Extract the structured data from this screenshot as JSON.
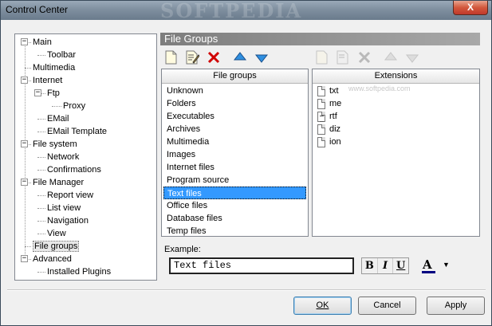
{
  "window": {
    "title": "Control Center",
    "watermark": "SOFTPEDIA",
    "close_label": "X"
  },
  "tree": {
    "items": [
      {
        "label": "Main",
        "level": 0,
        "expander": "−"
      },
      {
        "label": "Toolbar",
        "level": 1
      },
      {
        "label": "Multimedia",
        "level": 0
      },
      {
        "label": "Internet",
        "level": 0,
        "expander": "−"
      },
      {
        "label": "Ftp",
        "level": 1,
        "expander": "−"
      },
      {
        "label": "Proxy",
        "level": 2
      },
      {
        "label": "EMail",
        "level": 1
      },
      {
        "label": "EMail Template",
        "level": 1
      },
      {
        "label": "File system",
        "level": 0,
        "expander": "−"
      },
      {
        "label": "Network",
        "level": 1
      },
      {
        "label": "Confirmations",
        "level": 1
      },
      {
        "label": "File Manager",
        "level": 0,
        "expander": "−"
      },
      {
        "label": "Report view",
        "level": 1
      },
      {
        "label": "List view",
        "level": 1
      },
      {
        "label": "Navigation",
        "level": 1
      },
      {
        "label": "View",
        "level": 1
      },
      {
        "label": "File groups",
        "level": 0,
        "selected": true
      },
      {
        "label": "Advanced",
        "level": 0,
        "expander": "−"
      },
      {
        "label": "Installed Plugins",
        "level": 1
      }
    ]
  },
  "panel": {
    "title": "File Groups"
  },
  "groups": {
    "header": "File groups",
    "items": [
      "Unknown",
      "Folders",
      "Executables",
      "Archives",
      "Multimedia",
      "Images",
      "Internet files",
      "Program source",
      "Text files",
      "Office files",
      "Database files",
      "Temp files"
    ],
    "selected_index": 8
  },
  "extensions": {
    "header": "Extensions",
    "items": [
      "txt",
      "me",
      "rtf",
      "diz",
      "ion"
    ],
    "watermark": "www.softpedia.com"
  },
  "example": {
    "label": "Example:",
    "value": "Text files",
    "bold": "B",
    "italic": "I",
    "underline": "U",
    "color_glyph": "A",
    "dropdown": "▼"
  },
  "buttons": {
    "ok": "OK",
    "cancel": "Cancel",
    "apply": "Apply"
  },
  "colors": {
    "selection": "#3399ff",
    "title_gradient_start": "#9aa9b8",
    "close_button": "#c0392b"
  }
}
